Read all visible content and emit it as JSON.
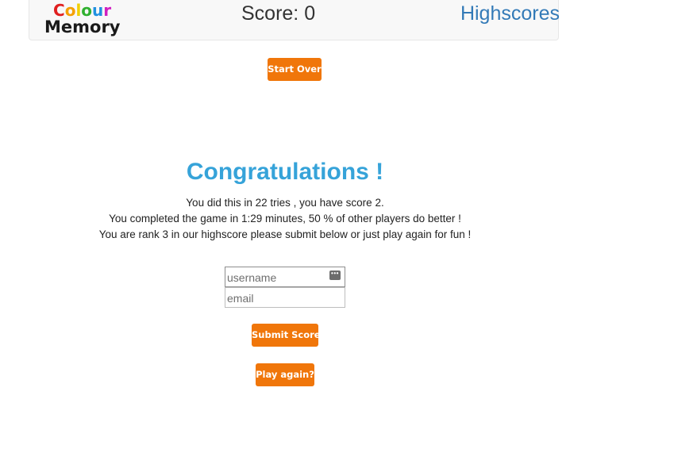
{
  "header": {
    "logo": {
      "line1_letters": [
        {
          "char": "C",
          "color": "#e02020"
        },
        {
          "char": "o",
          "color": "#f5a000"
        },
        {
          "char": "l",
          "color": "#f0d000"
        },
        {
          "char": "o",
          "color": "#30b030"
        },
        {
          "char": "u",
          "color": "#2090e0"
        },
        {
          "char": "r",
          "color": "#d020c0"
        }
      ],
      "line2": "Memory"
    },
    "score_text": "Score: 0",
    "highscores_label": "Highscores"
  },
  "actions": {
    "start_over_label": "Start Over",
    "submit_score_label": "Submit Score",
    "play_again_label": "Play again?"
  },
  "result": {
    "title": "Congratulations !",
    "line1": "You did this in 22 tries , you have score 2.",
    "line2": "You completed the game in 1:29 minutes, 50 % of other players do better !",
    "line3": "You are rank 3 in our highscore please submit below or just play again for fun !"
  },
  "form": {
    "username_placeholder": "username",
    "username_value": "",
    "email_placeholder": "email",
    "email_value": "",
    "keychain_icon_glyph": "•••"
  },
  "colors": {
    "accent_orange": "#f0760a",
    "title_blue": "#36a3d9",
    "link_blue": "#337ab7"
  }
}
